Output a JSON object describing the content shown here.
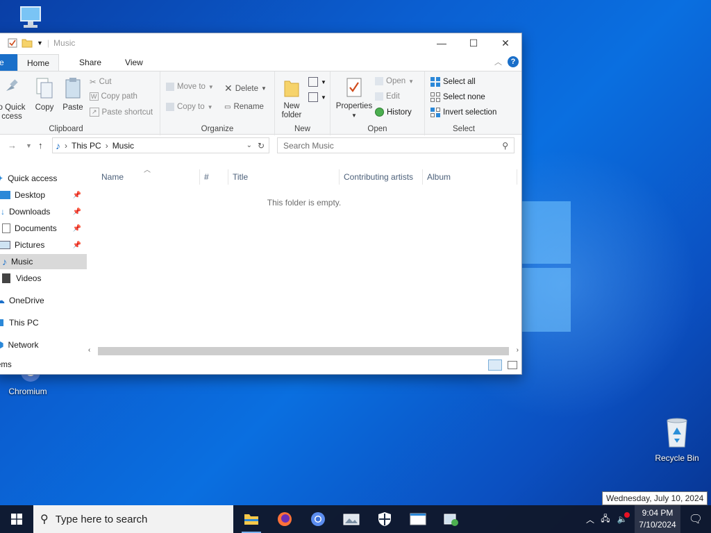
{
  "desktop": {
    "icons": [
      {
        "label": ""
      },
      {
        "label": "Chromium"
      },
      {
        "label": "Recycle Bin"
      }
    ]
  },
  "window": {
    "title": "Music",
    "tabs": {
      "file": "e",
      "home": "Home",
      "share": "Share",
      "view": "View"
    },
    "ribbon": {
      "clipboard": {
        "label": "Clipboard",
        "pin_line1": "o Quick",
        "pin_line2": "ccess",
        "copy": "Copy",
        "paste": "Paste",
        "cut": "Cut",
        "copy_path": "Copy path",
        "paste_shortcut": "Paste shortcut"
      },
      "organize": {
        "label": "Organize",
        "move_to": "Move to",
        "copy_to": "Copy to",
        "delete": "Delete",
        "rename": "Rename"
      },
      "new": {
        "label": "New",
        "new_folder_line1": "New",
        "new_folder_line2": "folder"
      },
      "open": {
        "label": "Open",
        "properties": "Properties",
        "open": "Open",
        "edit": "Edit",
        "history": "History"
      },
      "select": {
        "label": "Select",
        "select_all": "Select all",
        "select_none": "Select none",
        "invert_selection": "Invert selection"
      }
    },
    "address": {
      "segments": [
        "This PC",
        "Music"
      ]
    },
    "search_placeholder": "Search Music",
    "columns": [
      "Name",
      "#",
      "Title",
      "Contributing artists",
      "Album"
    ],
    "empty_text": "This folder is empty.",
    "nav": {
      "quick_access": "Quick access",
      "items": [
        "Desktop",
        "Downloads",
        "Documents",
        "Pictures",
        "Music",
        "Videos"
      ],
      "onedrive": "OneDrive",
      "this_pc": "This PC",
      "network": "Network"
    },
    "status": "ems"
  },
  "taskbar": {
    "search_placeholder": "Type here to search",
    "time": "9:04 PM",
    "date": "7/10/2024",
    "tooltip": "Wednesday, July 10, 2024"
  }
}
